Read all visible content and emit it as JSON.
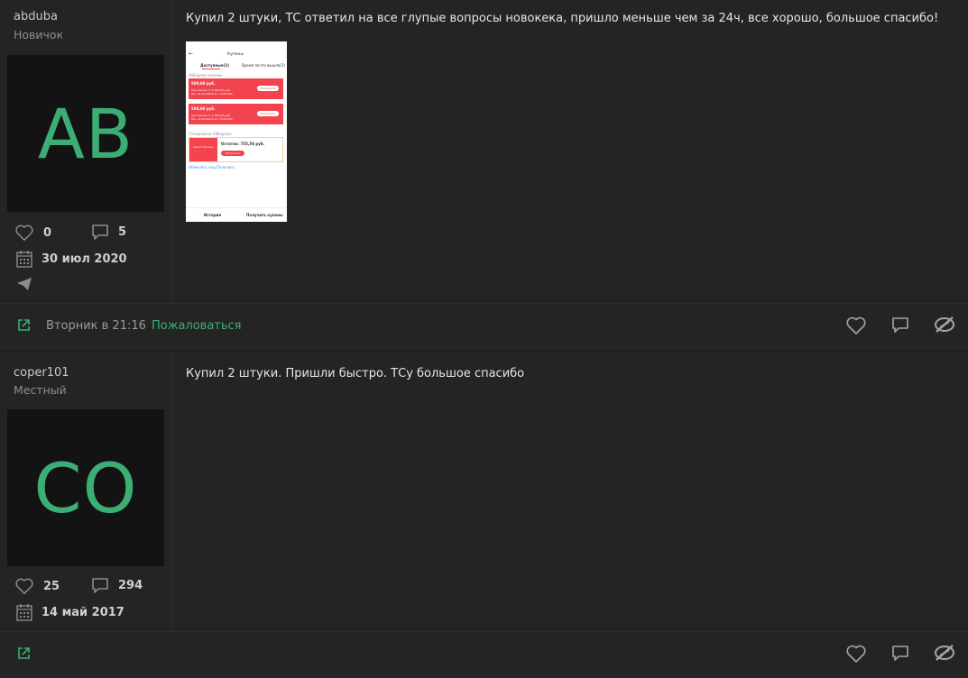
{
  "posts": [
    {
      "username": "abduba",
      "rank": "Новичок",
      "avatar_initials": "AB",
      "likes": "0",
      "messages": "5",
      "joined": "30 июл 2020",
      "text": "Купил 2 штуки, ТС ответил на все глупые вопросы новокека, пришло меньше чем за 24ч, все хорошо, большое спасибо!",
      "footer_date": "Вторник в 21:16",
      "report_label": "Пожаловаться",
      "attachment": {
        "header": "Купоны",
        "tab_available": "Доступные(3)",
        "tab_used": "Время почти вышло(3)",
        "section1": "AliExpress купоны",
        "coupon_amount": "500,00 руб.",
        "coupon_sub": "при заказе от 1 000,00 руб.",
        "coupon_dates": "Нач.: 11.09.2020  Конч.: 15.09.2020",
        "coupon_btn": "Потратить",
        "section2": "Специально AliExpress",
        "select_label": "Select Купоны",
        "balance": "Остаток: 755,56 руб.",
        "balance_btn": "Потратить",
        "links": "Обменять код  Получить",
        "bottom_left": "История",
        "bottom_right": "Получить купоны"
      }
    },
    {
      "username": "coper101",
      "rank": "Местный",
      "avatar_initials": "CO",
      "likes": "25",
      "messages": "294",
      "joined": "14 май 2017",
      "text": "Купил 2 штуки. Пришли быстро. ТСу большое спасибо"
    }
  ],
  "colors": {
    "accent": "#3dae73",
    "background": "#242424",
    "avatar_bg": "#131313"
  },
  "icons": [
    "heart-icon",
    "message-icon",
    "calendar-icon",
    "telegram-icon",
    "external-link-icon",
    "unlink-icon"
  ]
}
